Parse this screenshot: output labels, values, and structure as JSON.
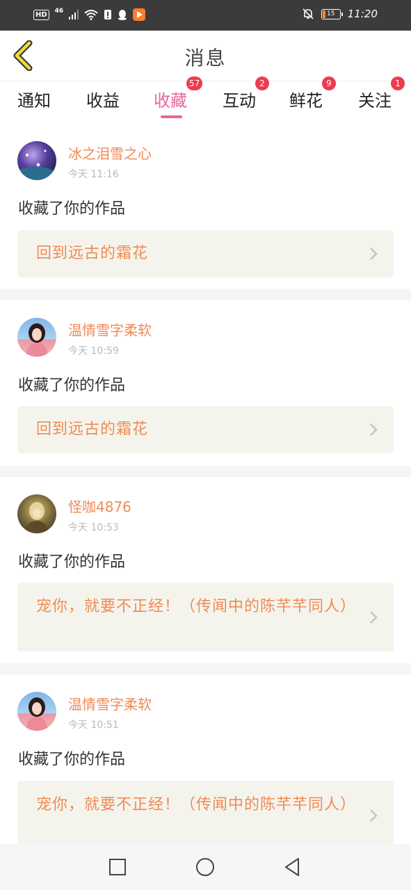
{
  "status_bar": {
    "hd": "HD",
    "network": "46",
    "battery": "15",
    "time": "11:20"
  },
  "header": {
    "title": "消息"
  },
  "tabs": [
    {
      "label": "通知",
      "badge": ""
    },
    {
      "label": "收益",
      "badge": ""
    },
    {
      "label": "收藏",
      "badge": "57"
    },
    {
      "label": "互动",
      "badge": "2"
    },
    {
      "label": "鲜花",
      "badge": "9"
    },
    {
      "label": "关注",
      "badge": "1"
    }
  ],
  "colors": {
    "accent": "#e5679c",
    "badge": "#ee3b4f",
    "username": "#ee8a57",
    "work_bg": "#f5f4ec"
  },
  "messages": [
    {
      "username": "冰之泪雪之心",
      "time": "今天 11:16",
      "action": "收藏了你的作品",
      "work_title": "回到远古的霜花"
    },
    {
      "username": "温情雪字柔软",
      "time": "今天 10:59",
      "action": "收藏了你的作品",
      "work_title": "回到远古的霜花"
    },
    {
      "username": "怪咖4876",
      "time": "今天 10:53",
      "action": "收藏了你的作品",
      "work_title": "宠你，就要不正经！（传闻中的陈芊芊同人）"
    },
    {
      "username": "温情雪字柔软",
      "time": "今天 10:51",
      "action": "收藏了你的作品",
      "work_title": "宠你，就要不正经！（传闻中的陈芊芊同人）"
    }
  ],
  "nav": {
    "icons": [
      "recent-apps-icon",
      "home-icon",
      "back-icon"
    ]
  }
}
